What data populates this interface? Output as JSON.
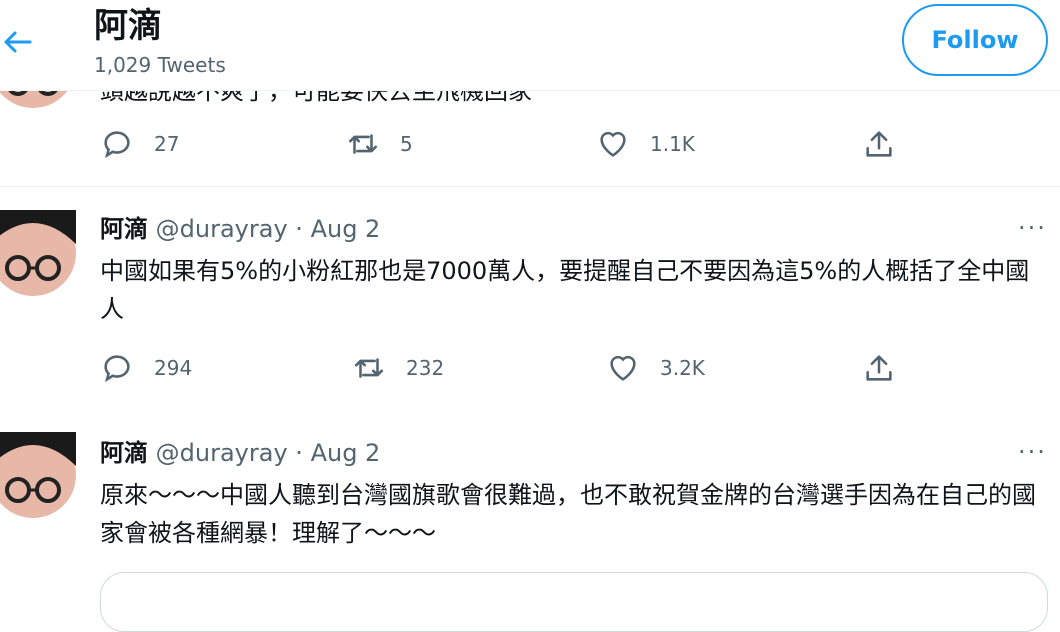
{
  "colors": {
    "accent": "#1d9bf0",
    "text": "#0f1419",
    "muted": "#536471",
    "border": "#eff3f4"
  },
  "header": {
    "back_icon": "arrow-left-icon",
    "title": "阿滴",
    "tweet_count": "1,029 Tweets",
    "follow_label": "Follow"
  },
  "tweets": [
    {
      "partial_text": "頭越說越不爽了，可能要快去坐飛機回家",
      "reply_count": "27",
      "retweet_count": "5",
      "like_count": "1.1K"
    },
    {
      "name": "阿滴",
      "handle": "@durayray",
      "separator": "·",
      "date": "Aug 2",
      "more": "···",
      "text": "中國如果有5%的小粉紅那也是7000萬人，要提醒自己不要因為這5%的人概括了全中國人",
      "reply_count": "294",
      "retweet_count": "232",
      "like_count": "3.2K"
    },
    {
      "name": "阿滴",
      "handle": "@durayray",
      "separator": "·",
      "date": "Aug 2",
      "more": "···",
      "text": "原來～～～中國人聽到台灣國旗歌會很難過，也不敢祝賀金牌的台灣選手因為在自己的國家會被各種網暴！理解了～～～"
    }
  ],
  "icons": [
    "reply-icon",
    "retweet-icon",
    "like-icon",
    "share-icon",
    "avatar"
  ]
}
